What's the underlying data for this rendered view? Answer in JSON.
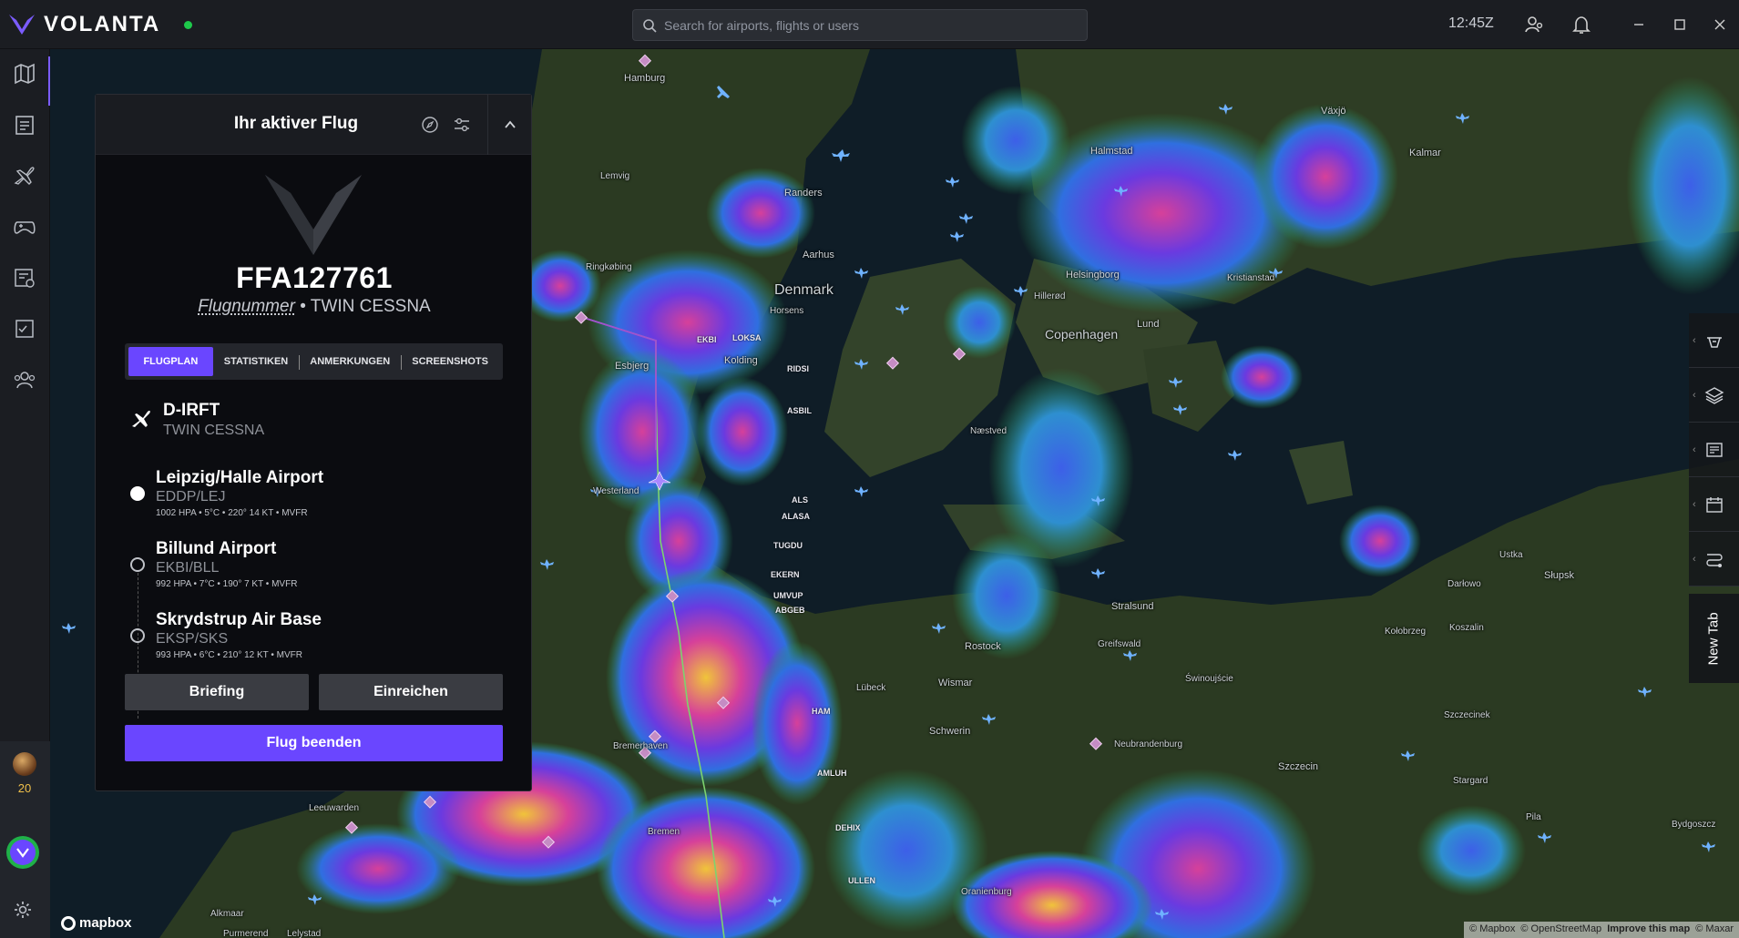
{
  "app": {
    "brand": "VOLANTA",
    "clock": "12:45Z"
  },
  "search": {
    "placeholder": "Search for airports, flights or users"
  },
  "sidebar": {
    "items": [
      {
        "icon": "map-icon"
      },
      {
        "icon": "logbook-icon"
      },
      {
        "icon": "aircraft-icon"
      },
      {
        "icon": "gamepad-icon"
      },
      {
        "icon": "flight-plan-icon"
      },
      {
        "icon": "checklist-icon"
      },
      {
        "icon": "community-icon"
      }
    ],
    "level": "20"
  },
  "panel": {
    "title": "Ihr aktiver Flug",
    "flight_number": "FFA127761",
    "flight_label": "Flugnummer",
    "aircraft_type": "TWIN CESSNA",
    "tabs": [
      "FLUGPLAN",
      "STATISTIKEN",
      "ANMERKUNGEN",
      "SCREENSHOTS"
    ],
    "aircraft": {
      "registration": "D-IRFT",
      "type": "TWIN CESSNA"
    },
    "airports": [
      {
        "name": "Leipzig/Halle Airport",
        "code": "EDDP/LEJ",
        "weather": "1002 HPA • 5°C • 220° 14 KT • MVFR"
      },
      {
        "name": "Billund Airport",
        "code": "EKBI/BLL",
        "weather": "992 HPA • 7°C • 190° 7 KT • MVFR"
      },
      {
        "name": "Skrydstrup Air Base",
        "code": "EKSP/SKS",
        "weather": "993 HPA • 6°C • 210° 12 KT • MVFR"
      }
    ],
    "buttons": {
      "briefing": "Briefing",
      "submit": "Einreichen",
      "end": "Flug beenden"
    }
  },
  "map": {
    "places": [
      {
        "name": "Halmstad"
      },
      {
        "name": "Växjö"
      },
      {
        "name": "Kalmar"
      },
      {
        "name": "Lemvig"
      },
      {
        "name": "Randers"
      },
      {
        "name": "Ringkøbing"
      },
      {
        "name": "Aarhus"
      },
      {
        "name": "Denmark"
      },
      {
        "name": "Horsens"
      },
      {
        "name": "Helsingborg"
      },
      {
        "name": "Kristianstad"
      },
      {
        "name": "Hillerød"
      },
      {
        "name": "Esbjerg"
      },
      {
        "name": "Kolding"
      },
      {
        "name": "Copenhagen"
      },
      {
        "name": "Lund"
      },
      {
        "name": "Næstved"
      },
      {
        "name": "Westerland"
      },
      {
        "name": "Ustka"
      },
      {
        "name": "Słupsk"
      },
      {
        "name": "Darłowo"
      },
      {
        "name": "Stralsund"
      },
      {
        "name": "Kołobrzeg"
      },
      {
        "name": "Koszalin"
      },
      {
        "name": "Rostock"
      },
      {
        "name": "Greifswald"
      },
      {
        "name": "Wismar"
      },
      {
        "name": "Świnoujście"
      },
      {
        "name": "Lübeck"
      },
      {
        "name": "Schwerin"
      },
      {
        "name": "Szczecinek"
      },
      {
        "name": "Bremerhaven"
      },
      {
        "name": "Neubrandenburg"
      },
      {
        "name": "Szczecin"
      },
      {
        "name": "Leeuwarden"
      },
      {
        "name": "Bremen"
      },
      {
        "name": "Pila"
      },
      {
        "name": "Bydgoszcz"
      },
      {
        "name": "Alkmaar"
      },
      {
        "name": "Oranienburg"
      },
      {
        "name": "Purmerend"
      },
      {
        "name": "Lelystad"
      },
      {
        "name": "Stargard"
      },
      {
        "name": "Hamburg"
      }
    ],
    "waypoints": [
      "EKBI",
      "LOKSA",
      "RIDSI",
      "ASBIL",
      "ALS",
      "ALASA",
      "TUGDU",
      "EKERN",
      "UMVUP",
      "ABGEB",
      "HAM",
      "AMLUH",
      "DEHIX",
      "ULLEN"
    ],
    "attribution": {
      "mapbox": "© Mapbox",
      "osm": "© OpenStreetMap",
      "improve": "Improve this map",
      "maxar": "© Maxar"
    },
    "logo_text": "mapbox"
  },
  "right_tools": {
    "items": [
      {
        "icon": "weather-icon"
      },
      {
        "icon": "layers-icon"
      },
      {
        "icon": "notes-icon"
      },
      {
        "icon": "calendar-icon"
      },
      {
        "icon": "route-icon"
      }
    ],
    "new_tab": "New Tab"
  }
}
